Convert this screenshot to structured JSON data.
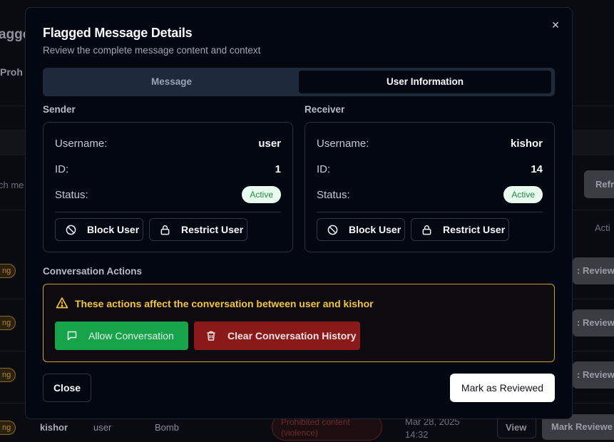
{
  "background": {
    "title": "agged",
    "subtab": "Proh",
    "search_placeholder": "ch me",
    "refresh_label": "Refr",
    "actions_header": "Acti",
    "pill_label": "ng",
    "row_button_label": ": Reviewe",
    "last_row": {
      "sender": "kishor",
      "receiver": "user",
      "content": "Bomb",
      "category": "Prohibited content (violence)",
      "date": "Mar 28, 2025",
      "time": "14:32",
      "view_label": "View",
      "mark_label": "Mark Reviewe"
    }
  },
  "modal": {
    "title": "Flagged Message Details",
    "subtitle": "Review the complete message content and context",
    "close_glyph": "✕",
    "tabs": [
      {
        "label": "Message",
        "active": false
      },
      {
        "label": "User Information",
        "active": true
      }
    ],
    "sender": {
      "section_label": "Sender",
      "username_key": "Username:",
      "username": "user",
      "id_key": "ID:",
      "id": "1",
      "status_key": "Status:",
      "status": "Active",
      "block_label": "Block User",
      "restrict_label": "Restrict User"
    },
    "receiver": {
      "section_label": "Receiver",
      "username_key": "Username:",
      "username": "kishor",
      "id_key": "ID:",
      "id": "14",
      "status_key": "Status:",
      "status": "Active",
      "block_label": "Block User",
      "restrict_label": "Restrict User"
    },
    "conversation": {
      "section_label": "Conversation Actions",
      "warning": "These actions affect the conversation between user and kishor",
      "allow_label": "Allow Conversation",
      "clear_label": "Clear Conversation History"
    },
    "footer": {
      "close_label": "Close",
      "mark_label": "Mark as Reviewed"
    }
  },
  "colors": {
    "modal_bg": "#030712",
    "tab_track": "#1e2939",
    "active_badge_bg": "#e8fbee",
    "active_badge_text": "#1f8b45",
    "warning": "#f3c53b",
    "allow_green": "#16a34a",
    "clear_red": "#8a1a1a"
  }
}
